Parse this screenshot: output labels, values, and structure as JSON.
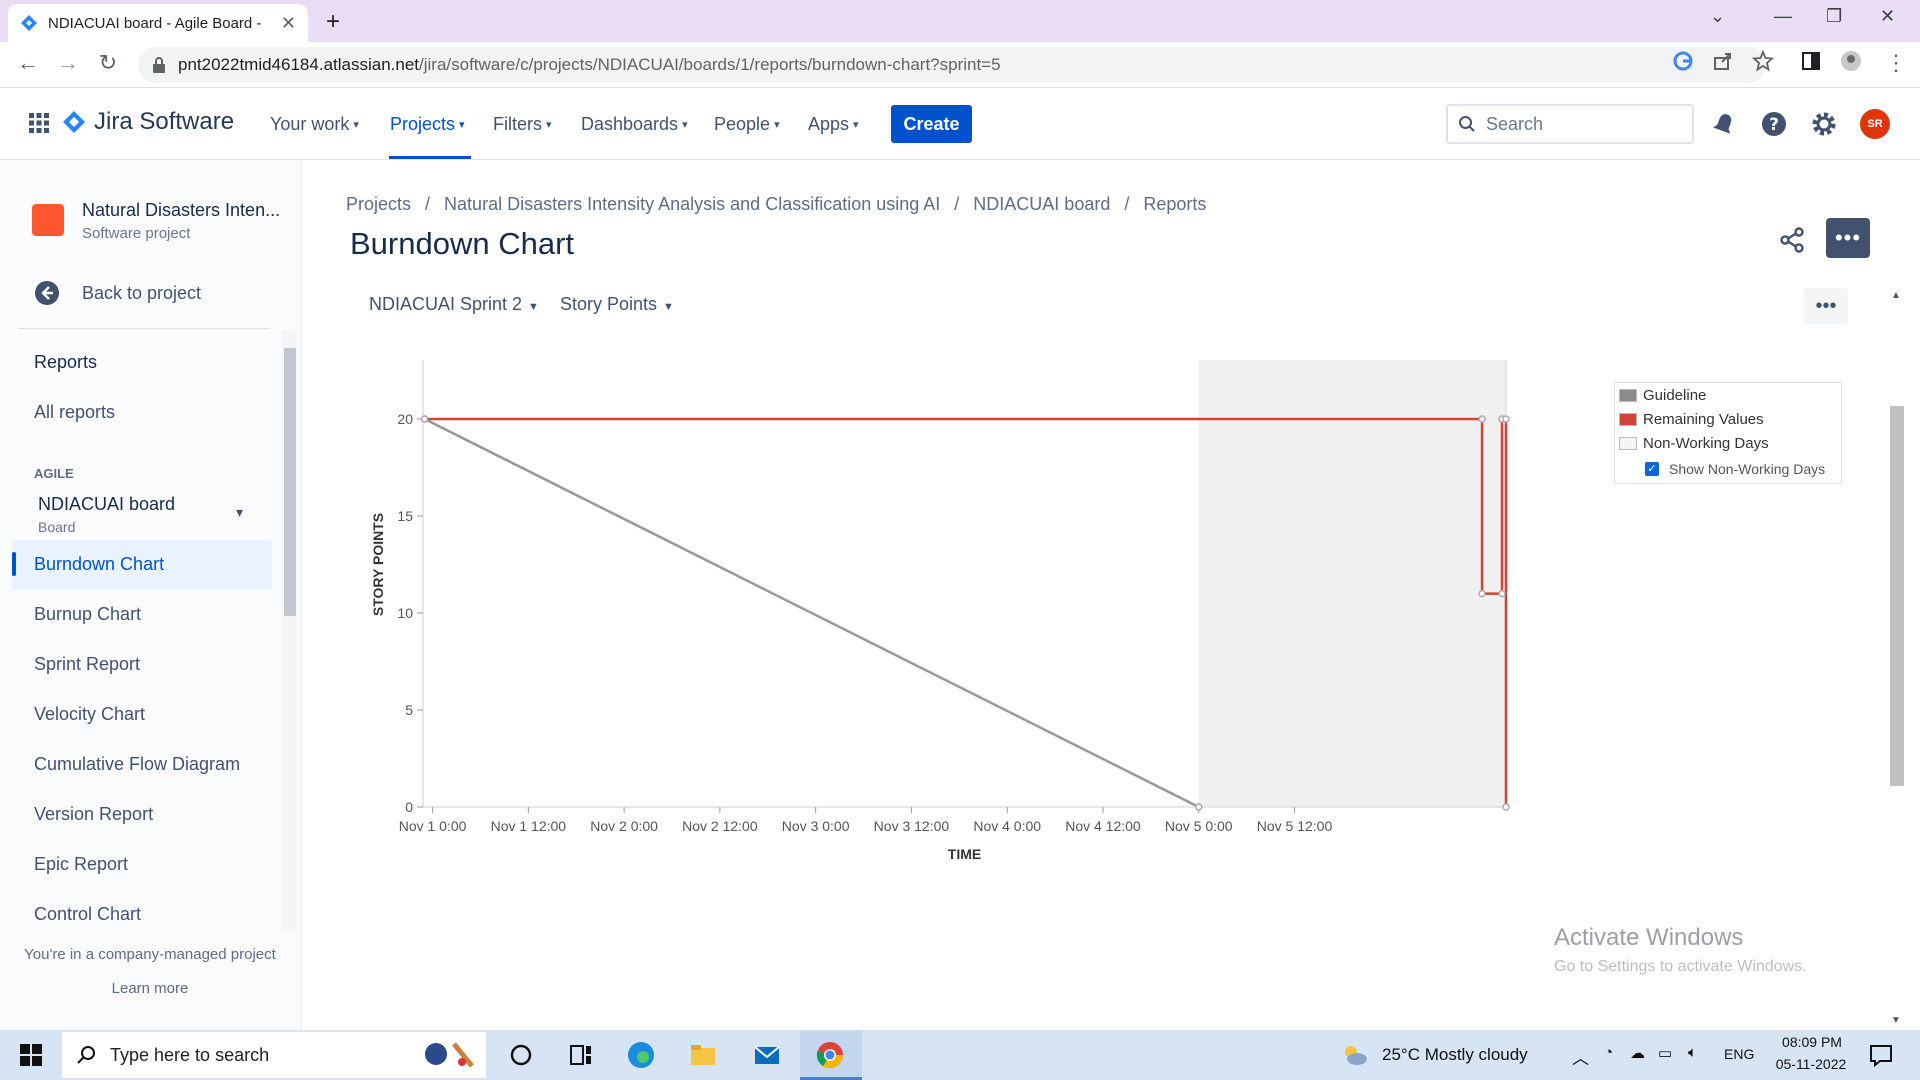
{
  "browser": {
    "tab_title": "NDIACUAI board - Agile Board -",
    "url_host": "pnt2022tmid46184.atlassian.net",
    "url_path": "/jira/software/c/projects/NDIACUAI/boards/1/reports/burndown-chart?sprint=5"
  },
  "header": {
    "product": "Jira Software",
    "nav": [
      "Your work",
      "Projects",
      "Filters",
      "Dashboards",
      "People",
      "Apps"
    ],
    "create": "Create",
    "search_placeholder": "Search",
    "avatar": "SR"
  },
  "sidebar": {
    "project_name": "Natural Disasters Inten...",
    "project_type": "Software project",
    "back": "Back to project",
    "reports_title": "Reports",
    "all_reports": "All reports",
    "agile_caption": "AGILE",
    "board_name": "NDIACUAI board",
    "board_type": "Board",
    "items": [
      "Burndown Chart",
      "Burnup Chart",
      "Sprint Report",
      "Velocity Chart",
      "Cumulative Flow Diagram",
      "Version Report",
      "Epic Report",
      "Control Chart"
    ],
    "note": "You're in a company-managed project",
    "learn_more": "Learn more"
  },
  "breadcrumbs": [
    "Projects",
    "/",
    "Natural Disasters Intensity Analysis and Classification using AI",
    "/",
    "NDIACUAI board",
    "/",
    "Reports"
  ],
  "page_title": "Burndown Chart",
  "filters": {
    "sprint": "NDIACUAI Sprint 2",
    "estimation": "Story Points"
  },
  "chart_data": {
    "type": "line",
    "xlabel": "TIME",
    "ylabel": "STORY POINTS",
    "ylim": [
      0,
      25
    ],
    "yticks": [
      0,
      5,
      10,
      15,
      20,
      25
    ],
    "x_tick_labels": [
      "Nov 1 0:00",
      "Nov 1 12:00",
      "Nov 2 0:00",
      "Nov 2 12:00",
      "Nov 3 0:00",
      "Nov 3 12:00",
      "Nov 4 0:00",
      "Nov 4 12:00",
      "Nov 5 0:00",
      "Nov 5 12:00"
    ],
    "x_range_hours": [
      -1.2,
      134.5
    ],
    "non_working_span_hours": [
      96,
      134.5
    ],
    "series": [
      {
        "name": "Guideline",
        "color": "#999999",
        "points": [
          [
            -1,
            20
          ],
          [
            96,
            0
          ]
        ]
      },
      {
        "name": "Remaining Values",
        "color": "#d04437",
        "points": [
          [
            -1,
            20
          ],
          [
            131.5,
            20
          ],
          [
            131.5,
            11
          ],
          [
            134,
            11
          ],
          [
            134,
            20
          ],
          [
            134.5,
            20
          ],
          [
            134.5,
            0
          ]
        ]
      }
    ],
    "legend": {
      "placement": "top-right",
      "entries": [
        "Guideline",
        "Remaining Values",
        "Non-Working Days"
      ],
      "checkbox": "Show Non-Working Days"
    },
    "grid": false
  },
  "watermark": {
    "line1": "Activate Windows",
    "line2": "Go to Settings to activate Windows."
  },
  "taskbar": {
    "search": "Type here to search",
    "weather": "25°C  Mostly cloudy",
    "lang": "ENG",
    "time": "08:09 PM",
    "date": "05-11-2022"
  }
}
